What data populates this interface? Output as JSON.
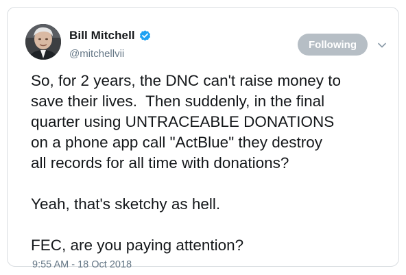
{
  "tweet": {
    "author": {
      "display_name": "Bill Mitchell",
      "handle": "@mitchellvii",
      "verified": true,
      "verified_color": "#1da1f2"
    },
    "follow_button": {
      "label": "Following",
      "color": "#b6bec5"
    },
    "menu_icon": "chevron-down-icon",
    "paragraphs": [
      "So, for 2 years, the DNC can't raise money to\nsave their lives.  Then suddenly, in the final\nquarter using UNTRACEABLE DONATIONS\non a phone app call \"ActBlue\" they destroy\nall records for all time with donations?",
      "Yeah, that's sketchy as hell.",
      "FEC, are you paying attention?"
    ],
    "timestamp": "9:55 AM - 18 Oct 2018"
  }
}
